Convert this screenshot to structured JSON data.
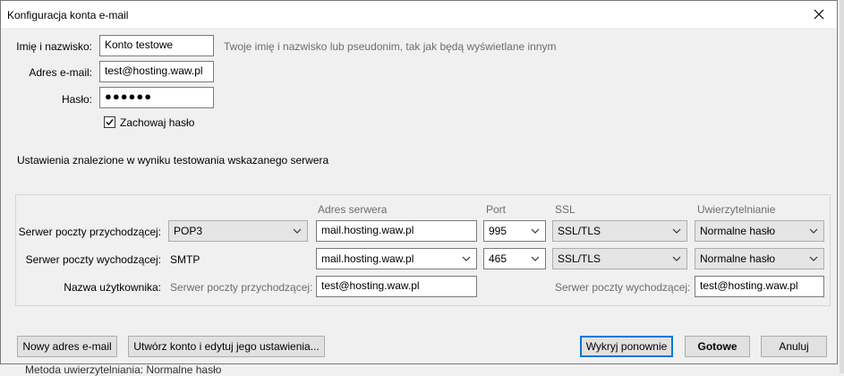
{
  "window": {
    "title": "Konfiguracja konta e-mail",
    "close_icon": "close-icon"
  },
  "form": {
    "name_label": "Imię i nazwisko:",
    "name_value": "Konto testowe",
    "name_hint": "Twoje imię i nazwisko lub pseudonim, tak jak będą wyświetlane innym",
    "email_label": "Adres e-mail:",
    "email_value": "test@hosting.waw.pl",
    "password_label": "Hasło:",
    "password_value": "●●●●●●",
    "remember_label": "Zachowaj hasło",
    "remember_checked": true
  },
  "status_text": "Ustawienia znalezione w wyniku testowania wskazanego serwera",
  "server": {
    "columns": {
      "address": "Adres serwera",
      "port": "Port",
      "ssl": "SSL",
      "auth": "Uwierzytelnianie"
    },
    "incoming": {
      "label": "Serwer poczty przychodzącej:",
      "protocol": "POP3",
      "address": "mail.hosting.waw.pl",
      "port": "995",
      "ssl": "SSL/TLS",
      "auth": "Normalne hasło"
    },
    "outgoing": {
      "label": "Serwer poczty wychodzącej:",
      "protocol": "SMTP",
      "address": "mail.hosting.waw.pl",
      "port": "465",
      "ssl": "SSL/TLS",
      "auth": "Normalne hasło"
    },
    "username": {
      "label": "Nazwa użytkownika:",
      "incoming_label": "Serwer poczty przychodzącej:",
      "incoming_value": "test@hosting.waw.pl",
      "outgoing_label": "Serwer poczty wychodzącej:",
      "outgoing_value": "test@hosting.waw.pl"
    }
  },
  "buttons": {
    "new_address": "Nowy adres e-mail",
    "create_edit": "Utwórz konto i edytuj jego ustawienia...",
    "detect_again": "Wykryj ponownie",
    "done": "Gotowe",
    "cancel": "Anuluj"
  },
  "background_text": "Metoda uwierzytelniania:  Normalne hasło"
}
